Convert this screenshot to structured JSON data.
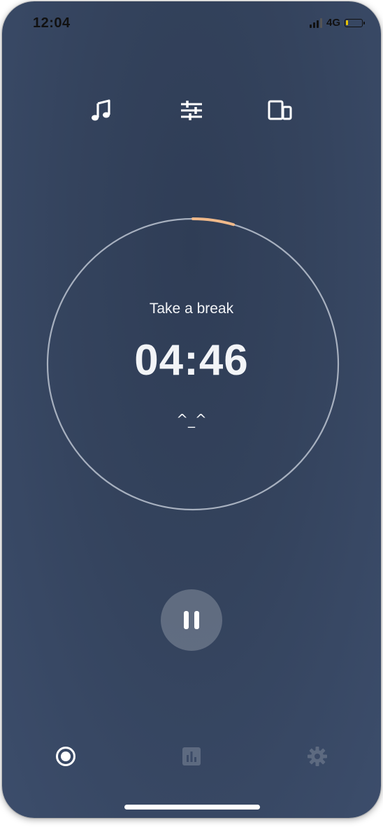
{
  "status_bar": {
    "time": "12:04",
    "network": "4G"
  },
  "toolbar": {
    "icons": [
      "music-note-icon",
      "sliders-icon",
      "devices-icon"
    ]
  },
  "timer": {
    "session_label": "Take a break",
    "remaining": "04:46",
    "emoticon": "^_^",
    "progress_fraction": 0.045,
    "progress_color": "#f0b98a",
    "ring_color": "#a7b0bf"
  },
  "controls": {
    "pause_icon": "pause-icon"
  },
  "bottom_nav": {
    "items": [
      {
        "icon": "timer-record-icon",
        "active": true
      },
      {
        "icon": "bar-chart-icon",
        "active": false
      },
      {
        "icon": "gear-icon",
        "active": false
      }
    ]
  },
  "colors": {
    "background": "#34435d",
    "accent": "#f0b98a",
    "text": "#f2f4f7"
  }
}
